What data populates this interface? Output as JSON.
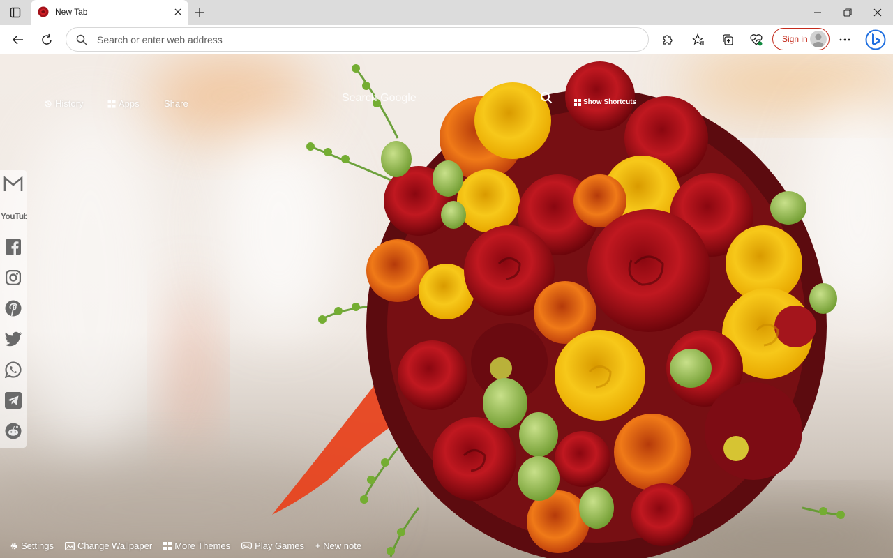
{
  "browser": {
    "tab_title": "New Tab",
    "address_placeholder": "Search or enter web address",
    "signin_label": "Sign in"
  },
  "newtab": {
    "top_links": [
      {
        "label": "History",
        "icon": "history-icon"
      },
      {
        "label": "Apps",
        "icon": "apps-grid-icon"
      },
      {
        "label": "Share",
        "icon": "share-icon"
      }
    ],
    "search_placeholder": "Search Google",
    "shortcuts_label": "Show Shortcuts",
    "social_links": [
      "gmail-icon",
      "youtube-icon",
      "facebook-icon",
      "instagram-icon",
      "pinterest-icon",
      "twitter-icon",
      "whatsapp-icon",
      "telegram-icon",
      "reddit-icon"
    ],
    "youtube_logo_text": "YouTube",
    "bottom_links": [
      {
        "label": "Settings",
        "icon": "gear-icon"
      },
      {
        "label": "Change Wallpaper",
        "icon": "wallpaper-icon"
      },
      {
        "label": "More Themes",
        "icon": "themes-grid-icon"
      },
      {
        "label": "Play Games",
        "icon": "gamepad-icon"
      },
      {
        "label": "+ New note",
        "icon": ""
      }
    ]
  },
  "colors": {
    "accent": "#c42b1c",
    "chrome_bg": "#dcdcdc"
  }
}
